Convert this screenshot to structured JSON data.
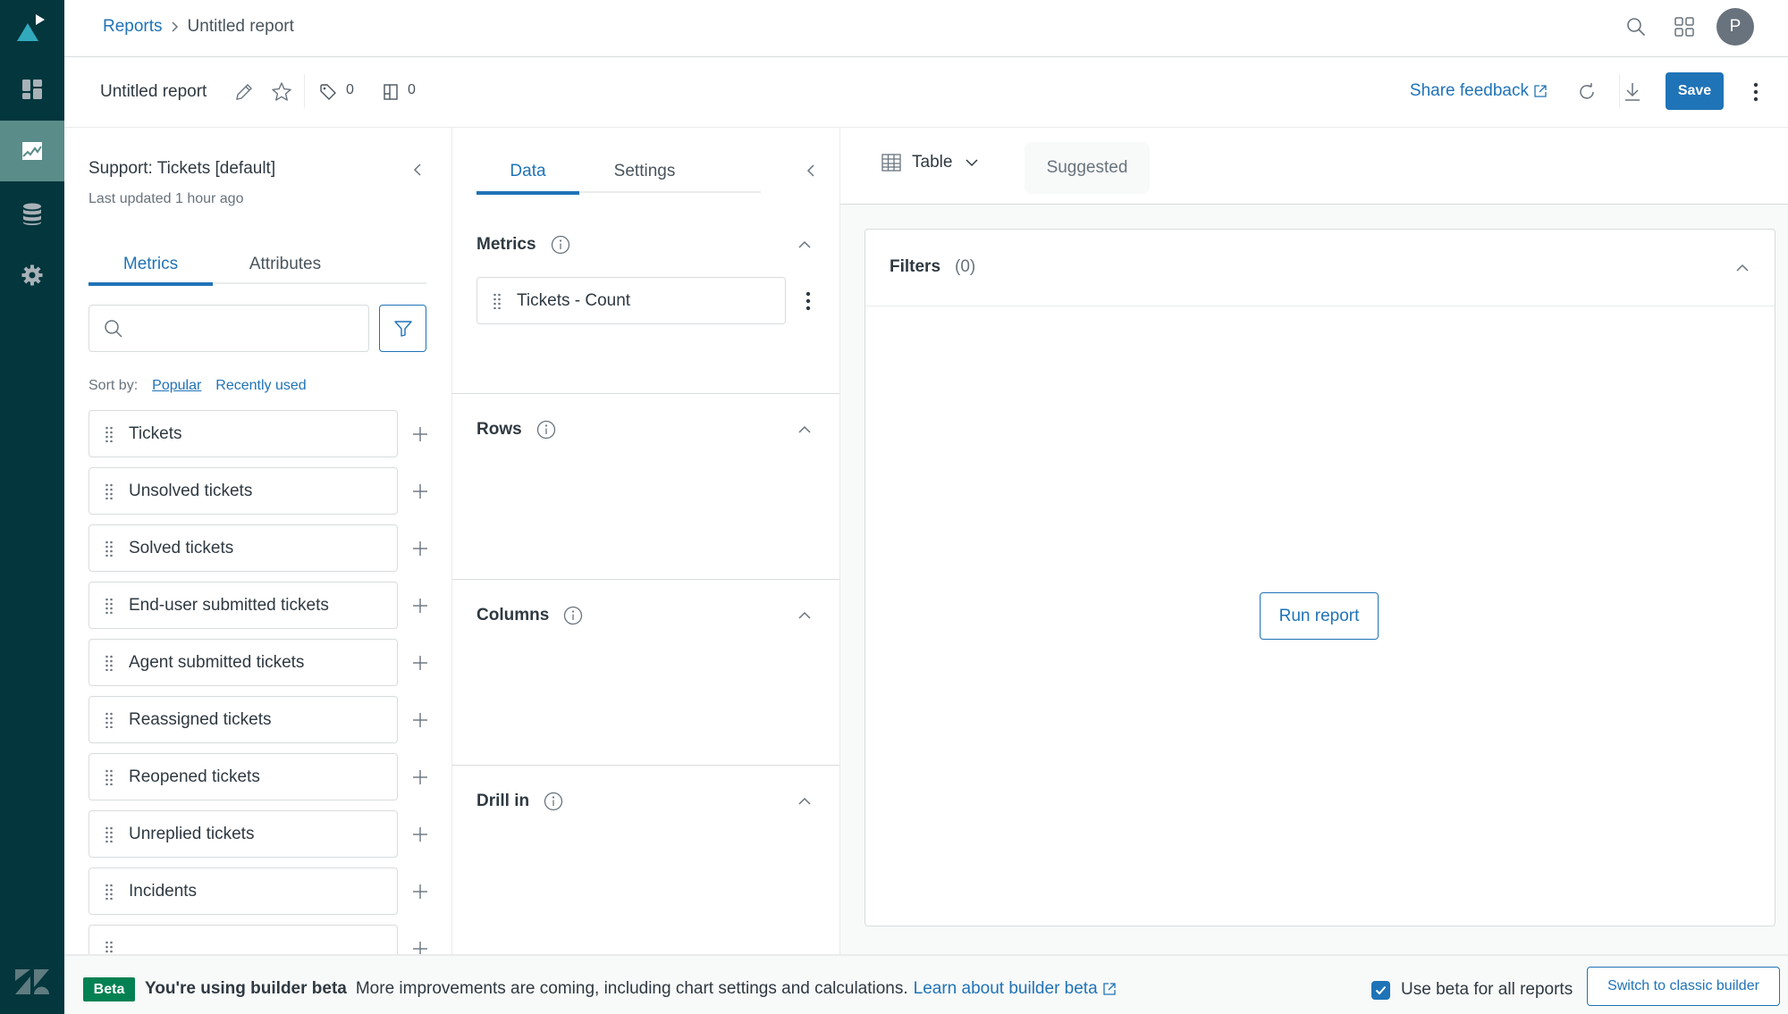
{
  "nav": {
    "items": [
      {
        "name": "dashboard",
        "icon": "dashboard-icon",
        "active": false
      },
      {
        "name": "reports",
        "icon": "chart-icon",
        "active": true
      },
      {
        "name": "datasets",
        "icon": "database-icon",
        "active": false
      },
      {
        "name": "admin",
        "icon": "gear-icon",
        "active": false
      }
    ]
  },
  "header": {
    "breadcrumb_root": "Reports",
    "breadcrumb_sep": ">",
    "breadcrumb_current": "Untitled report",
    "avatar_initial": "P"
  },
  "reportbar": {
    "title": "Untitled report",
    "tag_count": "0",
    "dashboard_count": "0",
    "share_feedback": "Share feedback",
    "save_label": "Save"
  },
  "dataset": {
    "title": "Support: Tickets [default]",
    "updated": "Last updated 1 hour ago",
    "tabs": [
      {
        "label": "Metrics",
        "active": true
      },
      {
        "label": "Attributes",
        "active": false
      }
    ],
    "search_value": "",
    "search_placeholder": "",
    "sort_label": "Sort by:",
    "sort_options": [
      {
        "label": "Popular",
        "selected": true
      },
      {
        "label": "Recently used",
        "selected": false
      }
    ],
    "metrics": [
      "Tickets",
      "Unsolved tickets",
      "Solved tickets",
      "End-user submitted tickets",
      "Agent submitted tickets",
      "Reassigned tickets",
      "Reopened tickets",
      "Unreplied tickets",
      "Incidents",
      ""
    ]
  },
  "config": {
    "tabs": [
      {
        "label": "Data",
        "active": true
      },
      {
        "label": "Settings",
        "active": false
      }
    ],
    "sections": {
      "metrics": {
        "title": "Metrics",
        "items": [
          "Tickets - Count"
        ]
      },
      "rows": {
        "title": "Rows"
      },
      "columns": {
        "title": "Columns"
      },
      "drill_in": {
        "title": "Drill in"
      }
    }
  },
  "main": {
    "viz_type": "Table",
    "suggested_label": "Suggested",
    "filters_title": "Filters",
    "filters_count": "(0)",
    "run_report": "Run report"
  },
  "banner": {
    "badge": "Beta",
    "headline": "You're using builder beta",
    "message": "More improvements are coming, including chart settings and calculations.",
    "link": "Learn about builder beta",
    "checkbox_label": "Use beta for all reports",
    "checkbox_checked": true,
    "switch_button": "Switch to classic builder"
  },
  "colors": {
    "nav_bg": "#03363d",
    "nav_active": "#5a8c89",
    "accent": "#1f73b7",
    "beta_green": "#038153",
    "logo_teal": "#30aabc"
  }
}
